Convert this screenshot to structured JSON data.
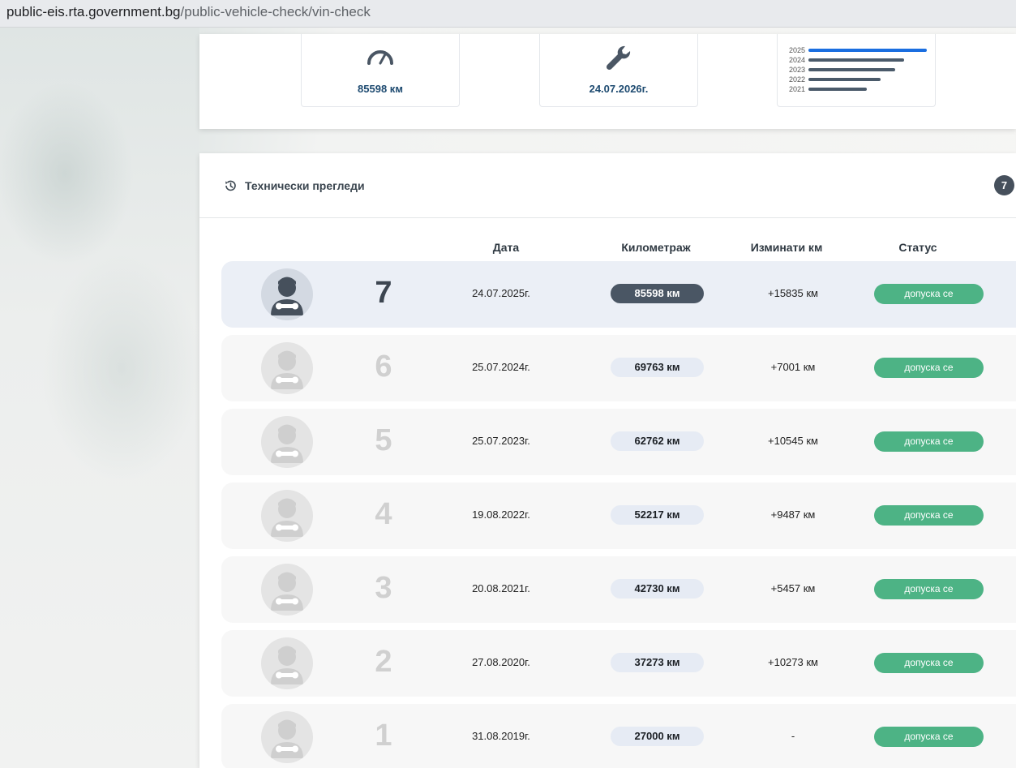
{
  "browser": {
    "url_host": "public-eis.rta.government.bg",
    "url_path": "/public-vehicle-check/vin-check"
  },
  "summary": {
    "mileage": "85598 км",
    "next_inspection": "24.07.2026г.",
    "year_chart": {
      "years": [
        "2025",
        "2024",
        "2023",
        "2022",
        "2021"
      ],
      "relative_values": [
        1.0,
        0.81,
        0.73,
        0.61,
        0.49
      ],
      "highlight_color": "#1a6ee0",
      "bar_color": "#4a5a6a"
    },
    "icons": [
      "speedometer-icon",
      "wrench-icon"
    ]
  },
  "inspections": {
    "title": "Технически прегледи",
    "count": "7",
    "columns": {
      "date": "Дата",
      "mileage": "Километраж",
      "diff": "Изминати км",
      "status": "Статус"
    },
    "rows": [
      {
        "num": "7",
        "date": "24.07.2025г.",
        "km": "85598 км",
        "diff": "+15835 км",
        "status": "допуска се"
      },
      {
        "num": "6",
        "date": "25.07.2024г.",
        "km": "69763 км",
        "diff": "+7001 км",
        "status": "допуска се"
      },
      {
        "num": "5",
        "date": "25.07.2023г.",
        "km": "62762 км",
        "diff": "+10545 км",
        "status": "допуска се"
      },
      {
        "num": "4",
        "date": "19.08.2022г.",
        "km": "52217 км",
        "diff": "+9487 км",
        "status": "допуска се"
      },
      {
        "num": "3",
        "date": "20.08.2021г.",
        "km": "42730 км",
        "diff": "+5457 км",
        "status": "допуска се"
      },
      {
        "num": "2",
        "date": "27.08.2020г.",
        "km": "37273 км",
        "diff": "+10273 км",
        "status": "допуска се"
      },
      {
        "num": "1",
        "date": "31.08.2019г.",
        "km": "27000 км",
        "diff": "-",
        "status": "допуска се"
      }
    ]
  },
  "colors": {
    "status_green": "#4db385",
    "active_row": "#ebeff6",
    "dark_badge": "#4a5664"
  }
}
